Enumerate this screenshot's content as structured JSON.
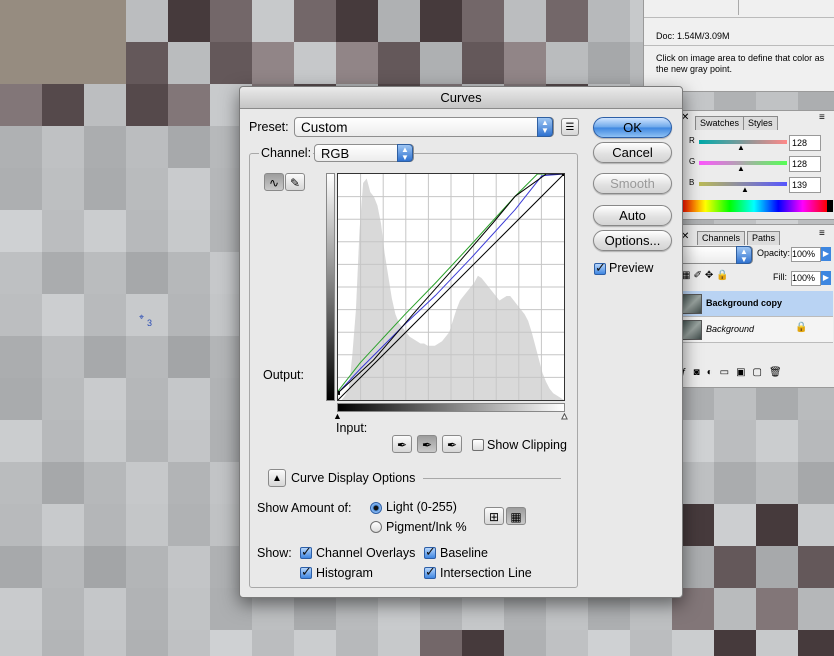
{
  "info_panel": {
    "doc_size": "Doc: 1.54M/3.09M",
    "hint": "Click on image area to define that color as the new gray point."
  },
  "color_panel": {
    "tabs": [
      "Swatches",
      "Styles"
    ],
    "sliders": [
      {
        "label": "R",
        "value": "128"
      },
      {
        "label": "G",
        "value": "128"
      },
      {
        "label": "B",
        "value": "139"
      }
    ]
  },
  "layers_panel": {
    "tabs": [
      "Channels",
      "Paths"
    ],
    "opacity_label": "Opacity:",
    "opacity_value": "100%",
    "fill_label": "Fill:",
    "fill_value": "100%",
    "layers": [
      {
        "name": "Background copy",
        "selected": true
      },
      {
        "name": "Background",
        "selected": false
      }
    ]
  },
  "canvas_marker": {
    "label": "3"
  },
  "curves_dialog": {
    "title": "Curves",
    "preset_label": "Preset:",
    "preset_value": "Custom",
    "channel_label": "Channel:",
    "channel_value": "RGB",
    "output_label": "Output:",
    "input_label": "Input:",
    "buttons": {
      "ok": "OK",
      "cancel": "Cancel",
      "smooth": "Smooth",
      "auto": "Auto",
      "options": "Options..."
    },
    "preview_label": "Preview",
    "preview_checked": true,
    "show_clipping_label": "Show Clipping",
    "show_clipping_checked": false,
    "curve_display_options_label": "Curve Display Options",
    "show_amount_label": "Show Amount of:",
    "light_label": "Light  (0-255)",
    "pigment_label": "Pigment/Ink %",
    "show_label": "Show:",
    "channel_overlays_label": "Channel Overlays",
    "baseline_label": "Baseline",
    "histogram_label": "Histogram",
    "intersection_label": "Intersection Line"
  },
  "colors": {
    "accent_blue": "#3d86e0",
    "layer_selected": "#b9d3f3",
    "curve_green": "#2aa12a",
    "curve_blue": "#3b3bd6",
    "curve_black": "#000000"
  },
  "chart_data": {
    "type": "line",
    "title": "",
    "xlabel": "Input",
    "ylabel": "Output",
    "xlim": [
      0,
      255
    ],
    "ylim": [
      0,
      255
    ],
    "grid": true,
    "series": [
      {
        "color": "#000000",
        "x": [
          0,
          255
        ],
        "y": [
          0,
          255
        ]
      },
      {
        "color": "#3b3bd6",
        "x": [
          0,
          25,
          75,
          110,
          150,
          200,
          230,
          255
        ],
        "y": [
          8,
          35,
          85,
          118,
          160,
          215,
          253,
          255
        ]
      },
      {
        "color": "#2aa12a",
        "x": [
          0,
          25,
          75,
          110,
          150,
          200,
          225,
          255
        ],
        "y": [
          10,
          42,
          96,
          132,
          175,
          230,
          255,
          255
        ]
      },
      {
        "color": "#000000",
        "x": [
          0,
          40,
          90,
          130,
          175,
          200,
          235,
          255
        ],
        "y": [
          8,
          45,
          103,
          148,
          200,
          230,
          255,
          255
        ]
      }
    ],
    "histogram": [
      0,
      0,
      2,
      5,
      20,
      40,
      75,
      96,
      98,
      92,
      90,
      86,
      78,
      65,
      55,
      45,
      38,
      34,
      32,
      30,
      28,
      27,
      26,
      25,
      25,
      24,
      24,
      24,
      25,
      26,
      28,
      30,
      35,
      40,
      44,
      46,
      48,
      50,
      52,
      55,
      54,
      52,
      50,
      48,
      46,
      44,
      45,
      46,
      46,
      44,
      42,
      40,
      38,
      35,
      30,
      24,
      18,
      12,
      8,
      5,
      3,
      2,
      1,
      0
    ]
  }
}
